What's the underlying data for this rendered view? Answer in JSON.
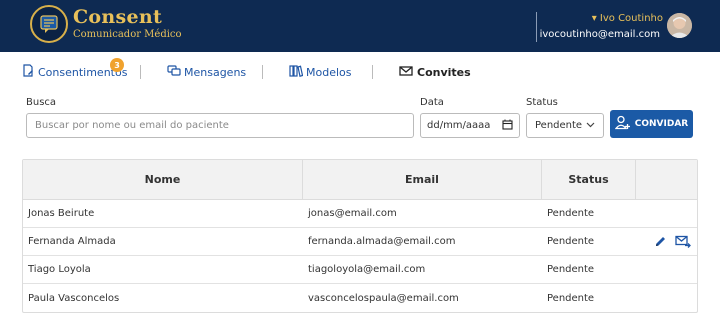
{
  "header": {
    "logo_title": "Consent",
    "logo_subtitle": "Comunicador Médico",
    "user_name": "▾ Ivo Coutinho",
    "user_email": "ivocoutinho@email.com"
  },
  "tabs": [
    {
      "label": "Consentimentos",
      "badge": "3",
      "icon": "document-edit-icon"
    },
    {
      "label": "Mensagens",
      "icon": "chat-icon"
    },
    {
      "label": "Modelos",
      "icon": "books-icon"
    },
    {
      "label": "Convites",
      "icon": "envelope-icon",
      "active": true
    }
  ],
  "filters": {
    "search_label": "Busca",
    "search_placeholder": "Buscar por nome ou email do paciente",
    "date_label": "Data",
    "date_value": "dd/mm/aaaa",
    "status_label": "Status",
    "status_value": "Pendente",
    "invite_button": "CONVIDAR"
  },
  "table": {
    "columns": [
      "Nome",
      "Email",
      "Status",
      ""
    ],
    "rows": [
      {
        "name": "Jonas Beirute",
        "email": "jonas@email.com",
        "status": "Pendente"
      },
      {
        "name": "Fernanda Almada",
        "email": "fernanda.almada@email.com",
        "status": "Pendente",
        "actions": [
          "edit-icon",
          "resend-mail-icon"
        ]
      },
      {
        "name": "Tiago Loyola",
        "email": "tiagoloyola@email.com",
        "status": "Pendente"
      },
      {
        "name": "Paula Vasconcelos",
        "email": "vasconcelospaula@email.com",
        "status": "Pendente"
      }
    ]
  },
  "colors": {
    "header_bg": "#0e2a52",
    "brand_gold": "#e8c05a",
    "primary_blue": "#1b5aa6",
    "badge_orange": "#f0a22d"
  }
}
